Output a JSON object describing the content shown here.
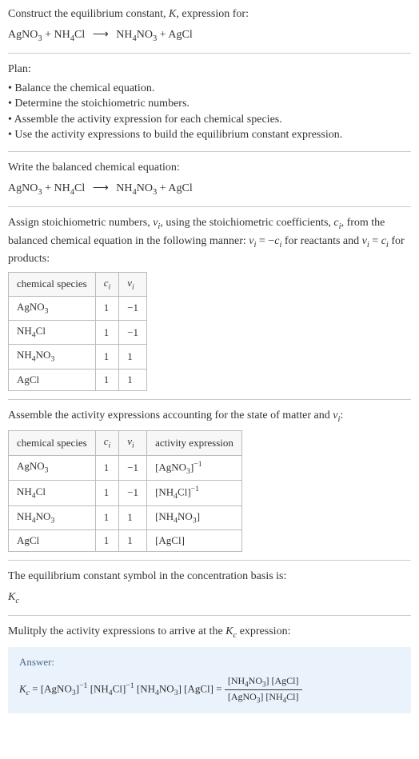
{
  "intro": {
    "line1": "Construct the equilibrium constant, ",
    "K": "K",
    "line1b": ", expression for:"
  },
  "eq1": {
    "r1": "AgNO",
    "r1sub": "3",
    "plus1": " + ",
    "r2": "NH",
    "r2sub": "4",
    "r2b": "Cl",
    "arrow": "⟶",
    "p1": "NH",
    "p1sub": "4",
    "p1b": "NO",
    "p1sub2": "3",
    "plus2": " + ",
    "p2": "AgCl"
  },
  "plan": {
    "title": "Plan:",
    "items": [
      "Balance the chemical equation.",
      "Determine the stoichiometric numbers.",
      "Assemble the activity expression for each chemical species.",
      "Use the activity expressions to build the equilibrium constant expression."
    ]
  },
  "balanced": {
    "title": "Write the balanced chemical equation:"
  },
  "stoich": {
    "line1a": "Assign stoichiometric numbers, ",
    "nu": "ν",
    "nuI": "i",
    "line1b": ", using the stoichiometric coefficients, ",
    "c": "c",
    "cI": "i",
    "line1c": ", from the balanced chemical equation in the following manner: ",
    "rel1a": "ν",
    "rel1b": "i",
    "rel1c": " = −",
    "rel1d": "c",
    "rel1e": "i",
    "line1d": " for reactants and ",
    "rel2a": "ν",
    "rel2b": "i",
    "rel2c": " = ",
    "rel2d": "c",
    "rel2e": "i",
    "line1e": " for products:"
  },
  "table1": {
    "h1": "chemical species",
    "h2c": "c",
    "h2i": "i",
    "h3n": "ν",
    "h3i": "i",
    "rows": [
      {
        "s1": "AgNO",
        "s1sub": "3",
        "c": "1",
        "v": "−1"
      },
      {
        "s1": "NH",
        "s1sub": "4",
        "s1b": "Cl",
        "c": "1",
        "v": "−1"
      },
      {
        "s1": "NH",
        "s1sub": "4",
        "s1b": "NO",
        "s1sub2": "3",
        "c": "1",
        "v": "1"
      },
      {
        "s1": "AgCl",
        "c": "1",
        "v": "1"
      }
    ]
  },
  "activity": {
    "line1a": "Assemble the activity expressions accounting for the state of matter and ",
    "nu": "ν",
    "nuI": "i",
    "line1b": ":"
  },
  "table2": {
    "h1": "chemical species",
    "h2c": "c",
    "h2i": "i",
    "h3n": "ν",
    "h3i": "i",
    "h4": "activity expression",
    "rows": [
      {
        "s1": "AgNO",
        "s1sub": "3",
        "c": "1",
        "v": "−1",
        "ae": "[AgNO",
        "aesub": "3",
        "aeb": "]",
        "aesup": "−1"
      },
      {
        "s1": "NH",
        "s1sub": "4",
        "s1b": "Cl",
        "c": "1",
        "v": "−1",
        "ae": "[NH",
        "aesub": "4",
        "aeb": "Cl]",
        "aesup": "−1"
      },
      {
        "s1": "NH",
        "s1sub": "4",
        "s1b": "NO",
        "s1sub2": "3",
        "c": "1",
        "v": "1",
        "ae": "[NH",
        "aesub": "4",
        "aeb": "NO",
        "aesub2": "3",
        "aec": "]"
      },
      {
        "s1": "AgCl",
        "c": "1",
        "v": "1",
        "ae": "[AgCl]"
      }
    ]
  },
  "kcSymbol": {
    "line1": "The equilibrium constant symbol in the concentration basis is:",
    "K": "K",
    "c": "c"
  },
  "multiply": {
    "line1a": "Mulitply the activity expressions to arrive at the ",
    "K": "K",
    "c": "c",
    "line1b": " expression:"
  },
  "answer": {
    "label": "Answer:",
    "K": "K",
    "Kc": "c",
    "eq": " = ",
    "t1": "[AgNO",
    "t1sub": "3",
    "t1b": "]",
    "t1sup": "−1",
    "t2": " [NH",
    "t2sub": "4",
    "t2b": "Cl]",
    "t2sup": "−1",
    "t3": " [NH",
    "t3sub": "4",
    "t3b": "NO",
    "t3sub2": "3",
    "t3c": "]",
    "t4": " [AgCl]",
    "eq2": " = ",
    "num1": "[NH",
    "num1sub": "4",
    "num1b": "NO",
    "num1sub2": "3",
    "num1c": "] [AgCl]",
    "den1": "[AgNO",
    "den1sub": "3",
    "den1b": "] [NH",
    "den1sub2": "4",
    "den1c": "Cl]"
  }
}
